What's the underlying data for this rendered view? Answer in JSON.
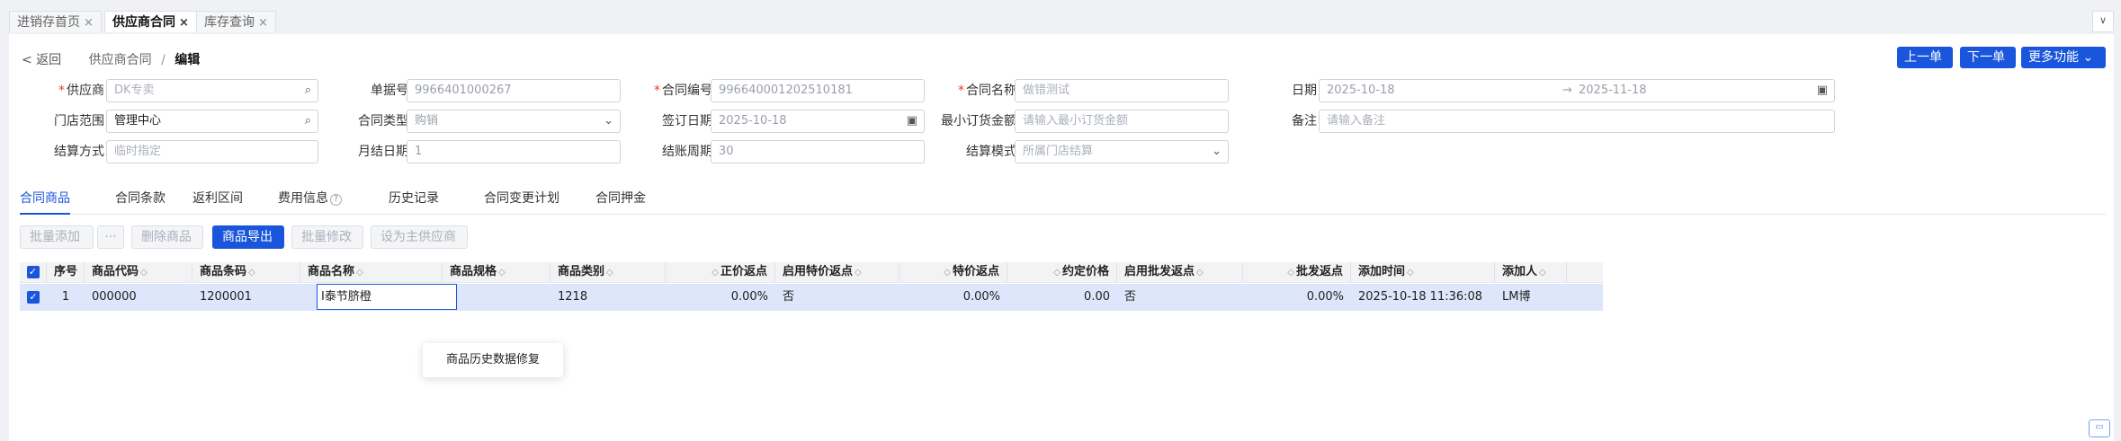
{
  "tabs": [
    {
      "label": "进销存首页",
      "close": "×"
    },
    {
      "label": "供应商合同",
      "close": "×"
    },
    {
      "label": "库存查询",
      "close": "×"
    }
  ],
  "tab_dropdown_icon": "chevron-down-icon",
  "breadcrumb": {
    "back": "< 返回",
    "parent": "供应商合同",
    "separator": "/",
    "current": "编辑"
  },
  "actions": {
    "prev": "上一单",
    "next": "下一单",
    "more": "更多功能",
    "more_chevron": "⌄"
  },
  "form": {
    "supplier": {
      "label": "供应商",
      "placeholder": "DK专卖"
    },
    "doc_no": {
      "label": "单据号",
      "value": "9966401000267"
    },
    "contract_no": {
      "label": "合同编号",
      "value": "996640001202510181"
    },
    "contract_name": {
      "label": "合同名称",
      "placeholder": "做错测试"
    },
    "date": {
      "label": "日期",
      "start": "2025-10-18",
      "arrow": "→",
      "end": "2025-11-18"
    },
    "store_scope": {
      "label": "门店范围",
      "value": "管理中心"
    },
    "contract_type": {
      "label": "合同类型",
      "value": "购销"
    },
    "sign_date": {
      "label": "签订日期",
      "value": "2025-10-18"
    },
    "min_order": {
      "label": "最小订货金额",
      "placeholder": "请输入最小订货金额"
    },
    "remark": {
      "label": "备注",
      "placeholder": "请输入备注"
    },
    "settle_method": {
      "label": "结算方式",
      "placeholder": "临时指定"
    },
    "month_end_date": {
      "label": "月结日期",
      "value": "1"
    },
    "settle_cycle": {
      "label": "结账周期",
      "value": "30"
    },
    "settle_mode": {
      "label": "结算模式",
      "placeholder": "所属门店结算"
    }
  },
  "subtabs": [
    "合同商品",
    "合同条款",
    "返利区间",
    "费用信息",
    "历史记录",
    "合同变更计划",
    "合同押金"
  ],
  "fee_info_hint": "?",
  "toolbar": {
    "batch_add": "批量添加",
    "more": "···",
    "delete": "删除商品",
    "export": "商品导出",
    "batch_edit": "批量修改",
    "set_main": "设为主供应商"
  },
  "table": {
    "headers": {
      "seq": "序号",
      "code": "商品代码",
      "barcode": "商品条码",
      "name": "商品名称",
      "spec": "商品规格",
      "category": "商品类别",
      "normal_rebate": "正价返点",
      "special_enabled": "启用特价返点",
      "special_rebate": "特价返点",
      "agreed_price": "约定价格",
      "wholesale_enabled": "启用批发返点",
      "wholesale_rebate": "批发返点",
      "added_time": "添加时间",
      "added_by": "添加人"
    },
    "sort_icon": "◇",
    "check_icon": "✓",
    "rows": [
      {
        "seq": "1",
        "code": "000000",
        "barcode": "1200001",
        "name": "I泰节脐橙",
        "spec": "",
        "category": "1218",
        "normal_rebate": "0.00%",
        "special_enabled": "否",
        "special_rebate": "0.00%",
        "agreed_price": "0.00",
        "wholesale_enabled": "否",
        "wholesale_rebate": "0.00%",
        "added_time": "2025-10-18 11:36:08",
        "added_by": "LM博"
      }
    ]
  },
  "context_menu": {
    "item": "商品历史数据修复"
  },
  "chat_icon": "chat-icon"
}
